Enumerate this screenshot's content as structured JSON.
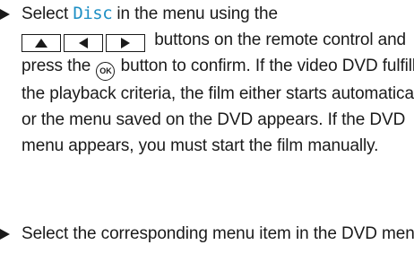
{
  "steps": [
    {
      "text_before_term": "Select ",
      "menu_term": "Disc",
      "text_after_term": " in the menu using the",
      "keys_suffix": "buttons on the remote control and press the",
      "ok_label": "OK",
      "text_after_ok": "button to confirm. If the video DVD fulfills the playback criteria, the film either starts automatically or the menu saved on the DVD appears. If the DVD menu appears, you must start the film manually."
    },
    {
      "text": "Select the corresponding menu item in the DVD menu."
    }
  ],
  "icons": {
    "bullet": "triangle-right-bullet",
    "keys": [
      "arrow-up-key",
      "arrow-left-key",
      "arrow-right-key"
    ],
    "ok": "ok-button-icon"
  },
  "colors": {
    "text": "#1a1a1a",
    "menu_term": "#1d8fc4"
  }
}
